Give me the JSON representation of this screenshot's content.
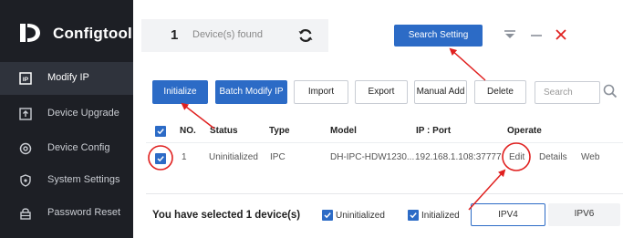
{
  "app": {
    "name": "Configtool"
  },
  "sidebar": {
    "items": [
      {
        "label": "Modify IP",
        "icon": "modify-ip-icon",
        "active": true
      },
      {
        "label": "Device Upgrade",
        "icon": "upload-icon",
        "active": false
      },
      {
        "label": "Device Config",
        "icon": "gear-icon",
        "active": false
      },
      {
        "label": "System Settings",
        "icon": "shield-icon",
        "active": false
      },
      {
        "label": "Password Reset",
        "icon": "lock-icon",
        "active": false
      }
    ]
  },
  "header": {
    "device_count": "1",
    "device_count_label": "Device(s) found",
    "search_setting_label": "Search Setting"
  },
  "toolbar": {
    "initialize_label": "Initialize",
    "batch_modify_label": "Batch Modify IP",
    "import_label": "Import",
    "export_label": "Export",
    "manual_add_label": "Manual Add",
    "delete_label": "Delete",
    "search_placeholder": "Search"
  },
  "table": {
    "headers": {
      "no": "NO.",
      "status": "Status",
      "type": "Type",
      "model": "Model",
      "ip_port": "IP : Port",
      "operate": "Operate"
    },
    "rows": [
      {
        "no": "1",
        "status": "Uninitialized",
        "type": "IPC",
        "model": "DH-IPC-HDW1230...",
        "ip_port": "192.168.1.108:37777",
        "edit": "Edit",
        "details": "Details",
        "web": "Web"
      }
    ]
  },
  "footer": {
    "selected_text": "You have selected 1  device(s)",
    "uninitialized_label": "Uninitialized",
    "initialized_label": "Initialized",
    "tabs": [
      "IPV4",
      "IPV6"
    ]
  },
  "colors": {
    "sidebar_bg": "#1d1f25",
    "accent": "#2c6bc6",
    "annotation": "#e0201f",
    "close_icon": "#e0201f"
  }
}
